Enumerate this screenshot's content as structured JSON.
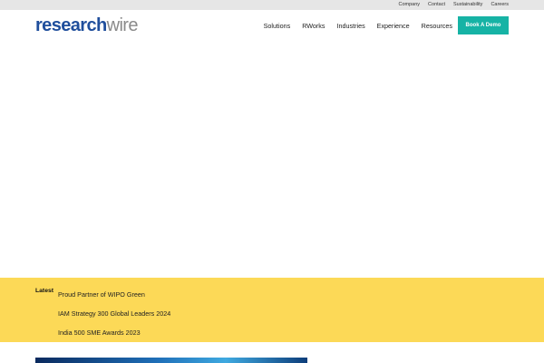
{
  "topbar": {
    "links": [
      "Company",
      "Contact",
      "Sustainability",
      "Careers"
    ]
  },
  "header": {
    "logo_part1": "research",
    "logo_part2": "wire",
    "nav": [
      "Solutions",
      "RWorks",
      "Industries",
      "Experience",
      "Resources"
    ],
    "cta_label": "Book A Demo"
  },
  "latest": {
    "label": "Latest",
    "items": [
      "Proud Partner of WIPO Green",
      "IAM Strategy 300 Global Leaders 2024",
      "India 500 SME Awards 2023"
    ]
  },
  "colors": {
    "brand_blue": "#1f4e9c",
    "accent_teal": "#16b3a5",
    "latest_yellow": "#fcd957",
    "topbar_gray": "#e6e6e6"
  }
}
